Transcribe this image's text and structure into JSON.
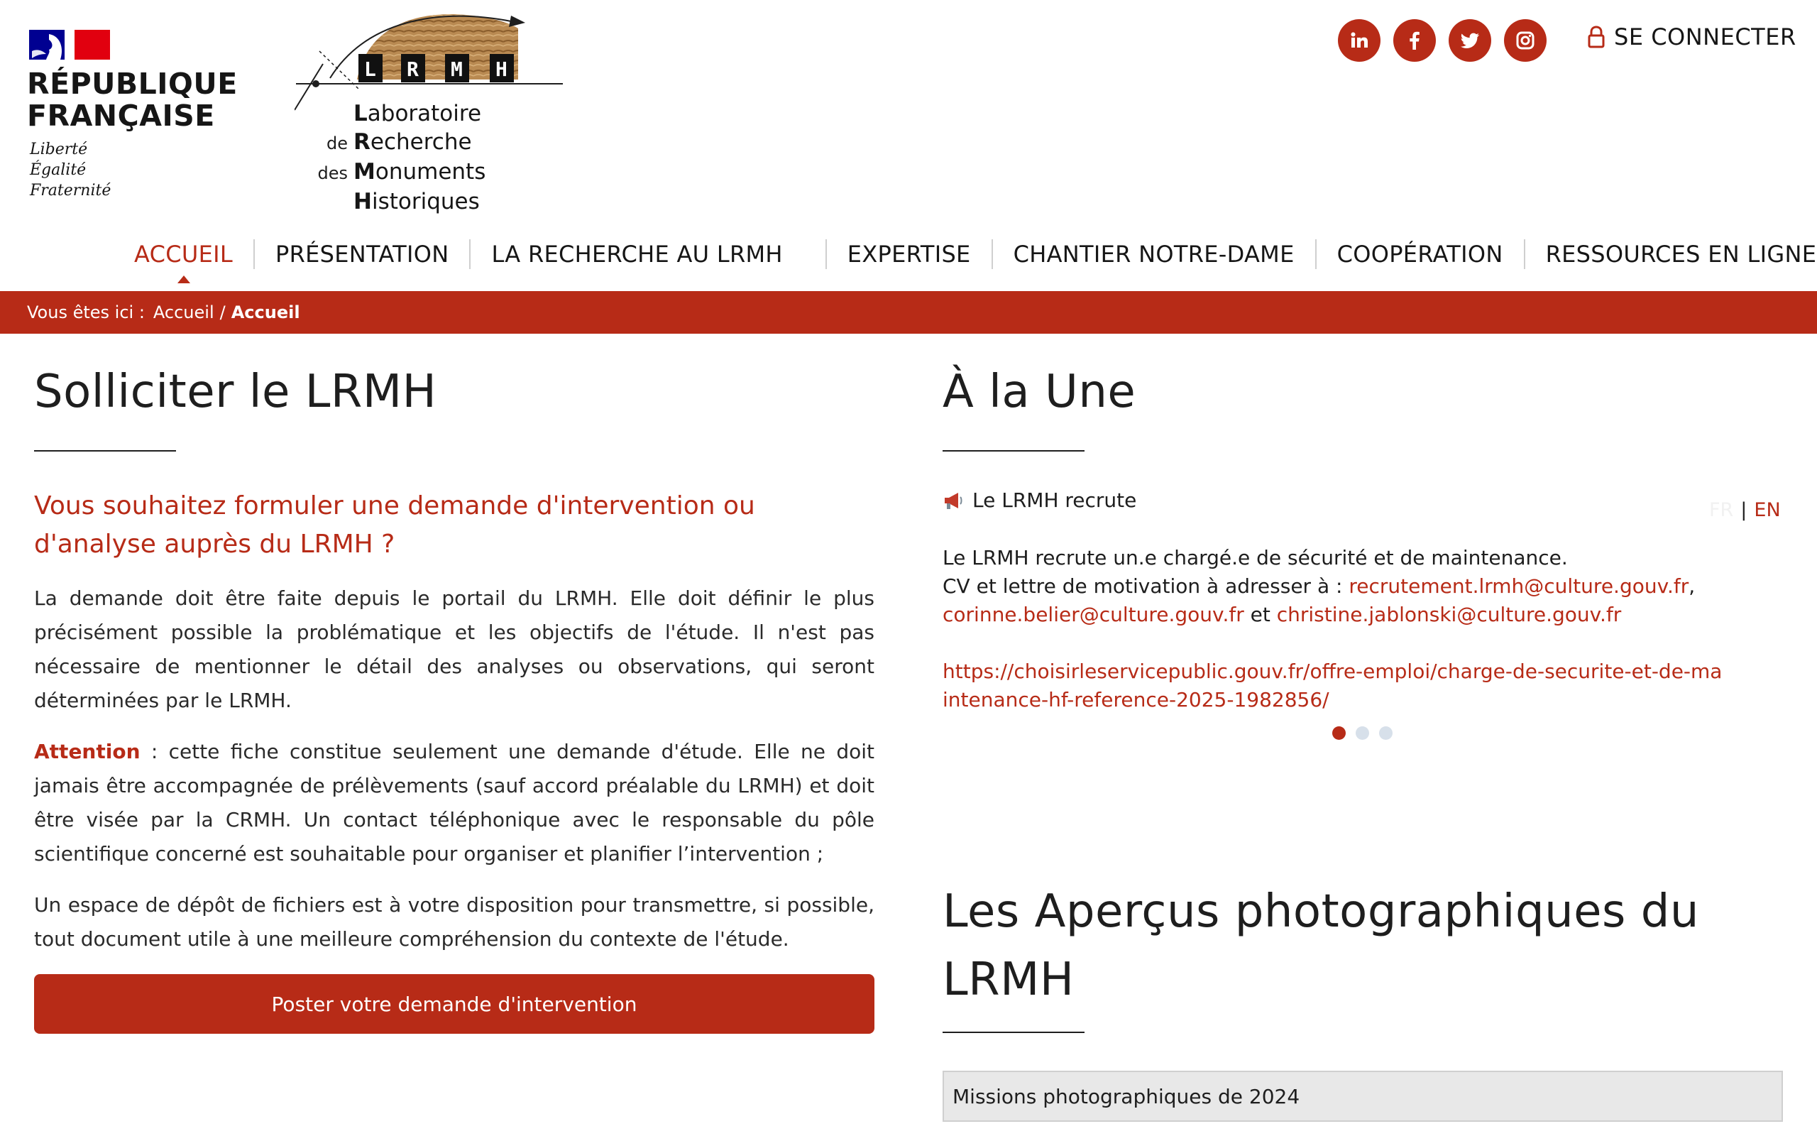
{
  "header": {
    "republique_line1": "RÉPUBLIQUE",
    "republique_line2": "FRANÇAISE",
    "motto": [
      "Liberté",
      "Égalité",
      "Fraternité"
    ],
    "lrmh_acronym": [
      "L",
      "R",
      "M",
      "H"
    ],
    "lrmh_name": [
      {
        "prefix": "",
        "initial": "L",
        "rest": "aboratoire"
      },
      {
        "prefix": "de",
        "initial": "R",
        "rest": "echerche"
      },
      {
        "prefix": "des",
        "initial": "M",
        "rest": "onuments"
      },
      {
        "prefix": "",
        "initial": "H",
        "rest": "istoriques"
      }
    ],
    "socials": [
      "linkedin-icon",
      "facebook-icon",
      "twitter-icon",
      "instagram-icon"
    ],
    "login_label": "SE CONNECTER"
  },
  "nav": {
    "items": [
      "ACCUEIL",
      "PRÉSENTATION",
      "LA RECHERCHE AU LRMH",
      "EXPERTISE",
      "CHANTIER NOTRE-DAME",
      "COOPÉRATION",
      "RESSOURCES EN LIGNE"
    ],
    "active": "ACCUEIL"
  },
  "breadcrumb": {
    "label": "Vous êtes ici :",
    "home": "Accueil",
    "separator": "/",
    "current": "Accueil"
  },
  "left": {
    "title": "Solliciter le LRMH",
    "subtitle": "Vous souhaitez formuler une demande d'intervention ou d'analyse auprès du LRMH ?",
    "p1": "La demande doit être faite depuis le portail du LRMH. Elle doit définir le plus précisément possible la problématique et les objectifs de l'étude. Il n'est pas nécessaire de mentionner le détail des analyses ou observations, qui seront déterminées par le LRMH.",
    "p2_attention": "Attention",
    "p2_rest": " : cette fiche constitue seulement une demande d'étude. Elle ne doit jamais être accompagnée de prélèvements (sauf accord préalable du LRMH) et doit être visée par la CRMH. Un contact téléphonique avec le responsable du pôle scientifique concerné est souhaitable pour organiser et planifier l’intervention ;",
    "p3": "Un espace de dépôt de fichiers est à votre disposition pour transmettre, si possible, tout document utile à une meilleure compréhension du contexte de l'étude.",
    "cta_label": "Poster votre demande d'intervention"
  },
  "right": {
    "title": "À la Une",
    "news_icon": "megaphone-icon",
    "news_title": "Le LRMH recrute",
    "lang_fr": "FR",
    "lang_sep": "|",
    "lang_en": "EN",
    "news_line1": "Le LRMH recrute un.e chargé.e de sécurité et de maintenance.",
    "news_line2_prefix": "CV et lettre de motivation à adresser à : ",
    "email1": "recrutement.lrmh@culture.gouv.fr",
    "comma": ",",
    "email2": "corinne.belier@culture.gouv.fr",
    "et": " et ",
    "email3": "christine.jablonski@culture.gouv.fr",
    "job_url": "https://choisirleservicepublic.gouv.fr/offre-emploi/charge-de-securite-et-de-maintenance-hf-reference-2025-1982856/",
    "carousel_count": 3,
    "carousel_active": 1,
    "photos_title": "Les Aperçus photographiques du LRMH",
    "photos_item": "Missions photographiques de 2024"
  },
  "colors": {
    "accent": "#b72b17",
    "text": "#1e1e1e",
    "dot_inactive": "#d7e0ea",
    "marianne_blue": "#000091",
    "marianne_red": "#e1000f"
  }
}
